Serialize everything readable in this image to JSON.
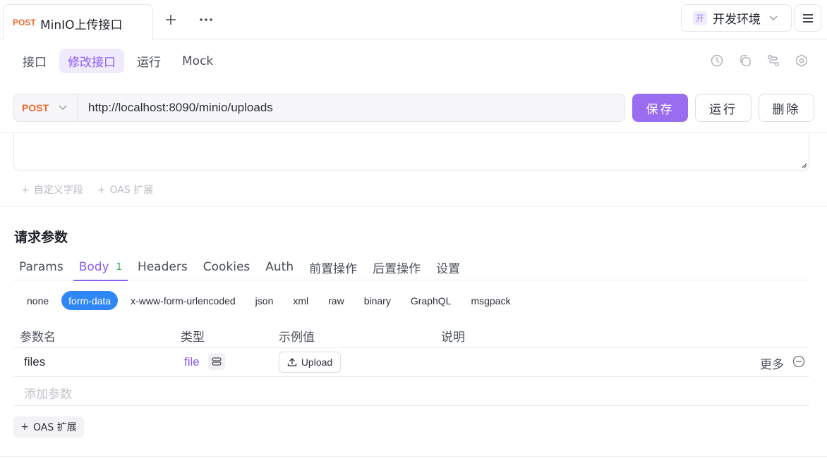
{
  "tab": {
    "method": "POST",
    "name": "MinIO上传接口"
  },
  "env": {
    "badge": "开",
    "label": "开发环境"
  },
  "subtabs": [
    {
      "label": "接口",
      "active": false
    },
    {
      "label": "修改接口",
      "active": true
    },
    {
      "label": "运行",
      "active": false
    },
    {
      "label": "Mock",
      "active": false
    }
  ],
  "request": {
    "method": "POST",
    "url": "http://localhost:8090/minio/uploads"
  },
  "actions": {
    "save": "保存",
    "run": "运行",
    "delete": "删除"
  },
  "extras": {
    "custom_field": "自定义字段",
    "oas": "OAS 扩展"
  },
  "params": {
    "title": "请求参数",
    "tabs": [
      {
        "label": "Params"
      },
      {
        "label": "Body",
        "count": "1",
        "active": true
      },
      {
        "label": "Headers"
      },
      {
        "label": "Cookies"
      },
      {
        "label": "Auth"
      },
      {
        "label": "前置操作"
      },
      {
        "label": "后置操作"
      },
      {
        "label": "设置"
      }
    ],
    "body_types": [
      "none",
      "form-data",
      "x-www-form-urlencoded",
      "json",
      "xml",
      "raw",
      "binary",
      "GraphQL",
      "msgpack"
    ],
    "active_body_type": "form-data",
    "columns": {
      "name": "参数名",
      "type": "类型",
      "example": "示例值",
      "desc": "说明"
    },
    "rows": [
      {
        "name": "files",
        "type": "file",
        "example_button": "Upload",
        "more": "更多"
      }
    ],
    "add_placeholder": "添加参数",
    "oas_button": "OAS 扩展"
  },
  "colors": {
    "accent": "#8b5cf6",
    "post": "#e9692c",
    "blue": "#2f86f6"
  }
}
